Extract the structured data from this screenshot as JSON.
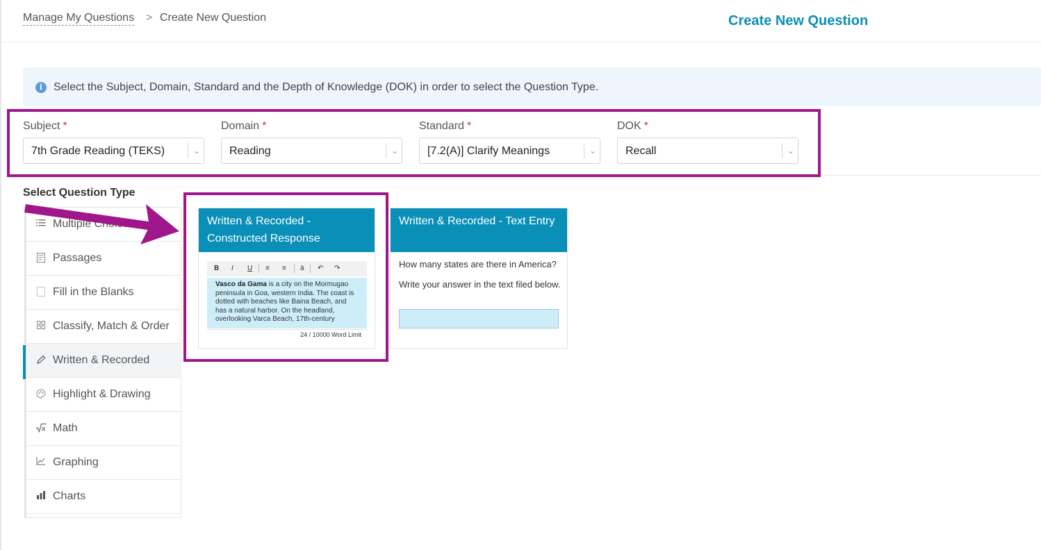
{
  "breadcrumb": {
    "link": "Manage My Questions",
    "separator": ">",
    "current": "Create New Question"
  },
  "page_title": "Create New Question",
  "info": {
    "text": "Select the Subject, Domain, Standard and the Depth of Knowledge (DOK) in order to select the Question Type."
  },
  "fields": {
    "subject": {
      "label": "Subject",
      "value": "7th Grade Reading (TEKS)"
    },
    "domain": {
      "label": "Domain",
      "value": "Reading"
    },
    "standard": {
      "label": "Standard",
      "value": "[7.2(A)] Clarify Meanings"
    },
    "dok": {
      "label": "DOK",
      "value": "Recall"
    },
    "required_mark": "*"
  },
  "section_title": "Select Question Type",
  "sidebar": {
    "items": [
      {
        "label": "Multiple Choice",
        "icon": "list-icon"
      },
      {
        "label": "Passages",
        "icon": "document-icon"
      },
      {
        "label": "Fill in the Blanks",
        "icon": "blank-box-icon"
      },
      {
        "label": "Classify, Match & Order",
        "icon": "grid-icon"
      },
      {
        "label": "Written & Recorded",
        "icon": "pencil-icon"
      },
      {
        "label": "Highlight & Drawing",
        "icon": "palette-icon"
      },
      {
        "label": "Math",
        "icon": "square-root-icon"
      },
      {
        "label": "Graphing",
        "icon": "line-chart-icon"
      },
      {
        "label": "Charts",
        "icon": "bar-chart-icon"
      }
    ],
    "active_index": 4
  },
  "cards": {
    "constructed": {
      "title": "Written & Recorded - Constructed Response",
      "toolbar": [
        "B",
        "I",
        "U",
        "≡",
        "≡",
        "ä",
        "↶",
        "↷"
      ],
      "body_bold": "Vasco da Gama",
      "body_text": " is a city on the Mormugao peninsula in Goa, western India. The coast is dotted with beaches like Baina Beach, and has a natural harbor. On the headland, overlooking Varca Beach, 17th-century",
      "word_count": "24  / 10000 Word Limit"
    },
    "text_entry": {
      "title": "Written & Recorded - Text Entry",
      "question": "How many states are there in America?",
      "instruction": "Write your answer in the text filed below."
    }
  },
  "colors": {
    "accent": "#0a8fb8",
    "highlight": "#a0178c",
    "required": "#d9302c",
    "info_bg": "#eef5fd"
  }
}
